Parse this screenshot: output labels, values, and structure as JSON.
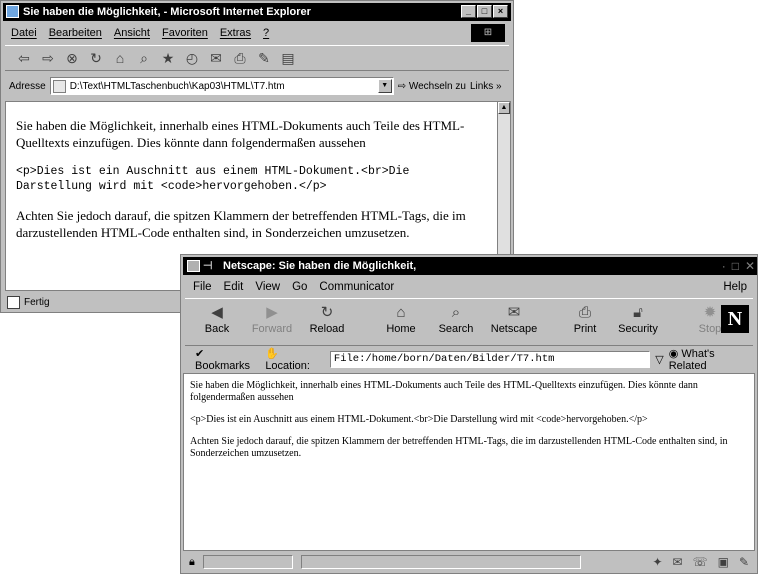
{
  "ie": {
    "title": "Sie haben die Möglichkeit, - Microsoft Internet Explorer",
    "window_buttons": [
      "_",
      "□",
      "×"
    ],
    "menu": [
      "Datei",
      "Bearbeiten",
      "Ansicht",
      "Favoriten",
      "Extras",
      "?"
    ],
    "address_label": "Adresse",
    "address_value": "D:\\Text\\HTMLTaschenbuch\\Kap03\\HTML\\T7.htm",
    "go_label": "Wechseln zu",
    "links_label": "Links »",
    "content": {
      "para1": "Sie haben die Möglichkeit, innerhalb eines HTML-Dokuments auch Teile des HTML-Quelltexts einzufügen. Dies könnte dann folgendermaßen aussehen",
      "code": "<p>Dies ist ein Auschnitt aus einem HTML-Dokument.<br>Die Darstellung wird mit <code>hervorgehoben.</p>",
      "para2": "Achten Sie jedoch darauf, die spitzen Klammern der betreffenden HTML-Tags, die im darzustellenden HTML-Code enthalten sind, in Sonderzeichen umzusetzen."
    },
    "status": "Fertig"
  },
  "ns": {
    "title": "Netscape: Sie haben die Möglichkeit,",
    "menu": [
      "File",
      "Edit",
      "View",
      "Go",
      "Communicator"
    ],
    "help": "Help",
    "toolbar": {
      "back": "Back",
      "forward": "Forward",
      "reload": "Reload",
      "home": "Home",
      "search": "Search",
      "netscape": "Netscape",
      "print": "Print",
      "security": "Security",
      "stop": "Stop"
    },
    "logo": "N",
    "bookmarks_label": "Bookmarks",
    "location_label": "Location:",
    "location_value": "File:/home/born/Daten/Bilder/T7.htm",
    "whats_related": "What's Related",
    "content": {
      "para1": "Sie haben die Möglichkeit, innerhalb eines HTML-Dokuments auch Teile des HTML-Quelltexts einzufügen. Dies könnte dann folgendermaßen aussehen",
      "para2": "<p>Dies ist ein Auschnitt aus einem HTML-Dokument.<br>Die Darstellung wird mit <code>hervorgehoben.</p>",
      "para3": "Achten Sie jedoch darauf, die spitzen Klammern der betreffenden HTML-Tags, die im darzustellenden HTML-Code enthalten sind, in Sonderzeichen umzusetzen."
    }
  }
}
